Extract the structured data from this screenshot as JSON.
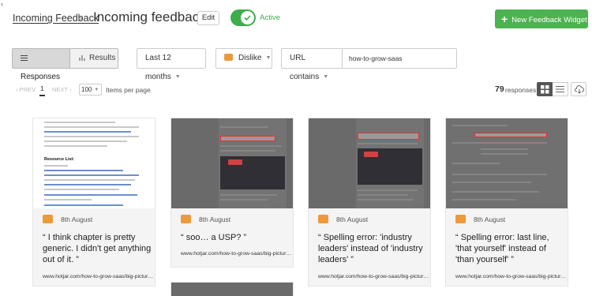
{
  "header": {
    "back_glyph": "‹",
    "breadcrumb_link": "Incoming Feedback",
    "breadcrumb_sep": "›",
    "title": "Incoming feedback",
    "edit_label": "Edit",
    "toggle_label": "Active",
    "toggle_state": "on",
    "new_widget_label": "New Feedback Widget"
  },
  "filters": {
    "tabs": [
      {
        "label": "Responses",
        "icon": "list-icon",
        "active": true
      },
      {
        "label": "Results",
        "icon": "bar-chart-icon",
        "active": false
      }
    ],
    "date_range": "Last 12 months",
    "rating": "Dislike",
    "url_filter": "URL contains",
    "url_value": "how-to-grow-saas"
  },
  "pagination": {
    "prev": "‹ PREV",
    "page": "1",
    "next": "NEXT ›",
    "per_page": "100",
    "per_page_label": "Items per page",
    "count": "79",
    "count_label": "responses"
  },
  "colors": {
    "accent_green": "#4cb34f",
    "dislike_orange": "#ec9a3c"
  },
  "cards": [
    {
      "date": "8th August",
      "quote": "“ I think chapter is pretty generic. I didn't get anything out of it. ”",
      "url": "www.hotjar.com/how-to-grow-saas/big-pictur…",
      "shot_heading": "Resource List:"
    },
    {
      "date": "8th August",
      "quote": "“ soo… a USP? ”",
      "url": "www.hotjar.com/how-to-grow-saas/big-pictur…"
    },
    {
      "date": "8th August",
      "quote": "“ Spelling error: 'industry leaders' instead of 'industry leaders' ”",
      "url": "www.hotjar.com/how-to-grow-saas/big-pictur…"
    },
    {
      "date": "8th August",
      "quote": "“ Spelling error: last line, 'that yourself' instead of 'than yourself' ”",
      "url": "www.hotjar.com/how-to-grow-saas/big-pictur…"
    }
  ]
}
